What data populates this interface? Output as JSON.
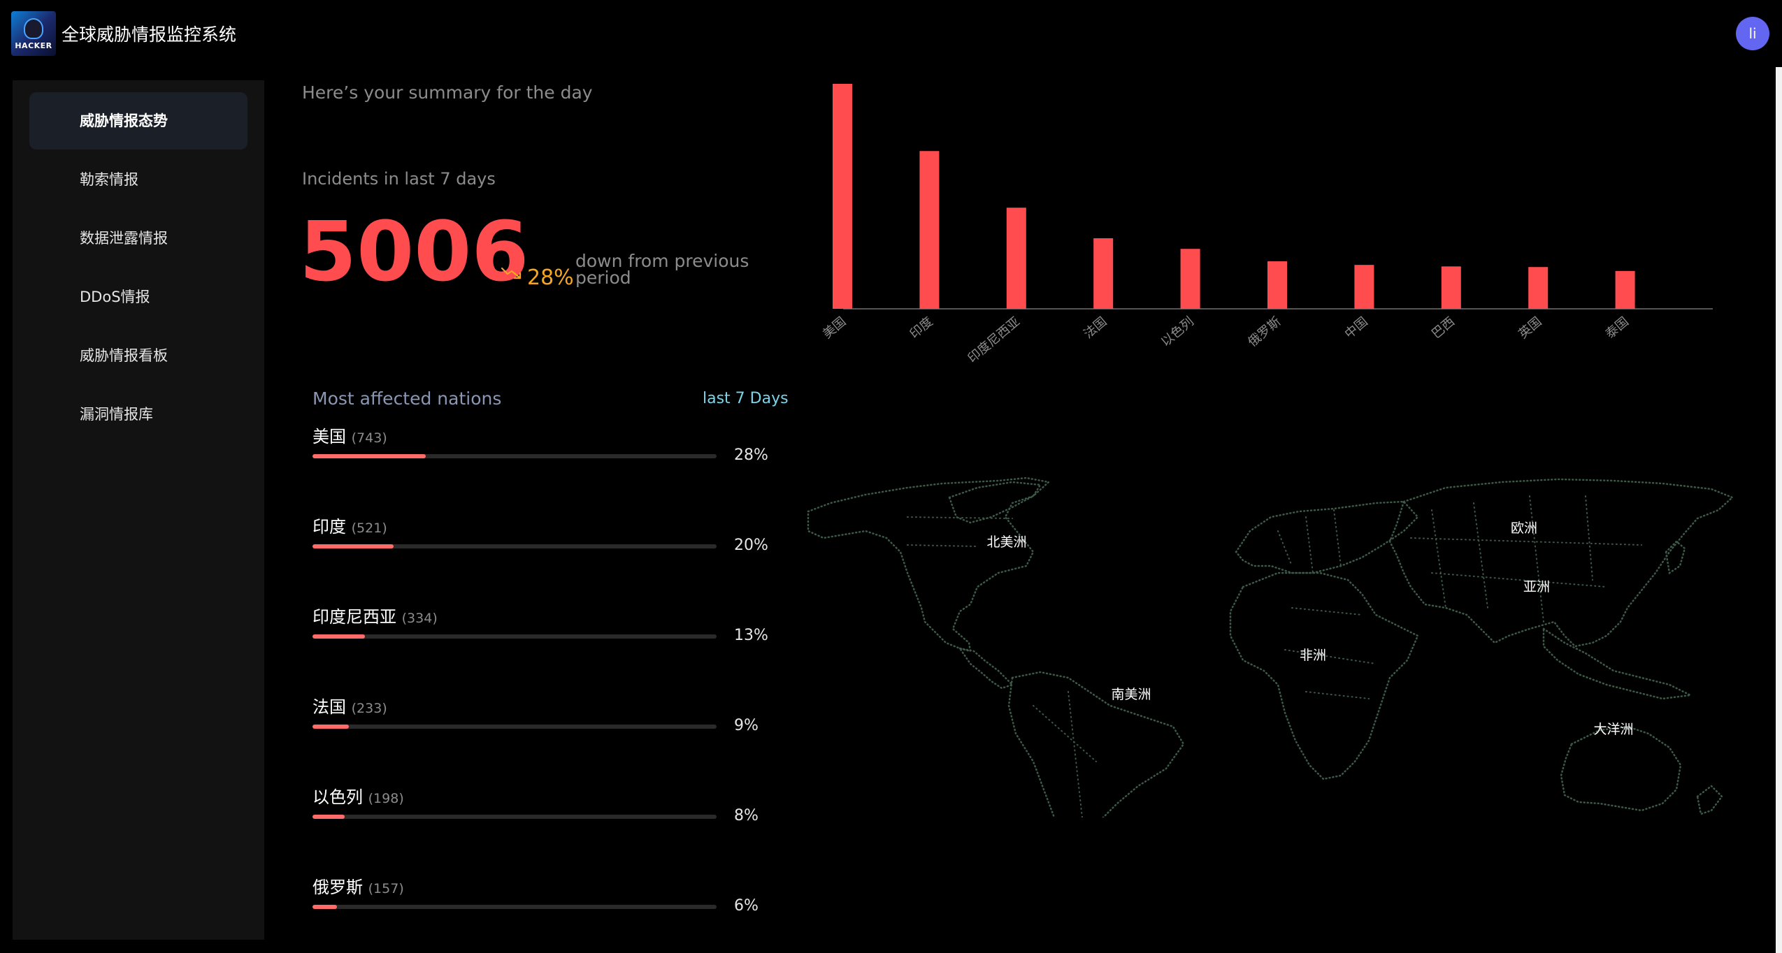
{
  "header": {
    "app_title": "全球威胁情报监控系统",
    "logo_text": "HACKER",
    "user_initial": "li"
  },
  "sidebar": {
    "items": [
      {
        "label": "威胁情报态势",
        "active": true
      },
      {
        "label": "勒索情报",
        "active": false
      },
      {
        "label": "数据泄露情报",
        "active": false
      },
      {
        "label": "DDoS情报",
        "active": false
      },
      {
        "label": "威胁情报看板",
        "active": false
      },
      {
        "label": "漏洞情报库",
        "active": false
      }
    ]
  },
  "summary": {
    "greeting": "Here’s your summary for the day",
    "incidents_label": "Incidents in last 7 days",
    "incidents_value": "5006",
    "trend_percent": "28%",
    "trend_text": "down from previous period",
    "trend_icon": "trend-down-icon"
  },
  "affected": {
    "title": "Most affected nations",
    "range": "last 7 Days",
    "nations": [
      {
        "name": "美国",
        "count": "(743)",
        "percent": "28%",
        "fraction": 0.28
      },
      {
        "name": "印度",
        "count": "(521)",
        "percent": "20%",
        "fraction": 0.2
      },
      {
        "name": "印度尼西亚",
        "count": "(334)",
        "percent": "13%",
        "fraction": 0.13
      },
      {
        "name": "法国",
        "count": "(233)",
        "percent": "9%",
        "fraction": 0.09
      },
      {
        "name": "以色列",
        "count": "(198)",
        "percent": "8%",
        "fraction": 0.08
      },
      {
        "name": "俄罗斯",
        "count": "(157)",
        "percent": "6%",
        "fraction": 0.06
      }
    ]
  },
  "chart_data": {
    "type": "bar",
    "categories": [
      "美国",
      "印度",
      "印度尼西亚",
      "法国",
      "以色列",
      "俄罗斯",
      "中国",
      "巴西",
      "英国",
      "泰国"
    ],
    "values": [
      743,
      521,
      334,
      233,
      198,
      157,
      145,
      140,
      138,
      125
    ],
    "ylim": [
      0,
      743
    ],
    "color": "#ff4d4f",
    "grid": false
  },
  "map": {
    "labels": [
      "北美洲",
      "欧洲",
      "亚洲",
      "非洲",
      "南美洲",
      "大洋洲"
    ],
    "dot_color": "#3d5a48"
  }
}
